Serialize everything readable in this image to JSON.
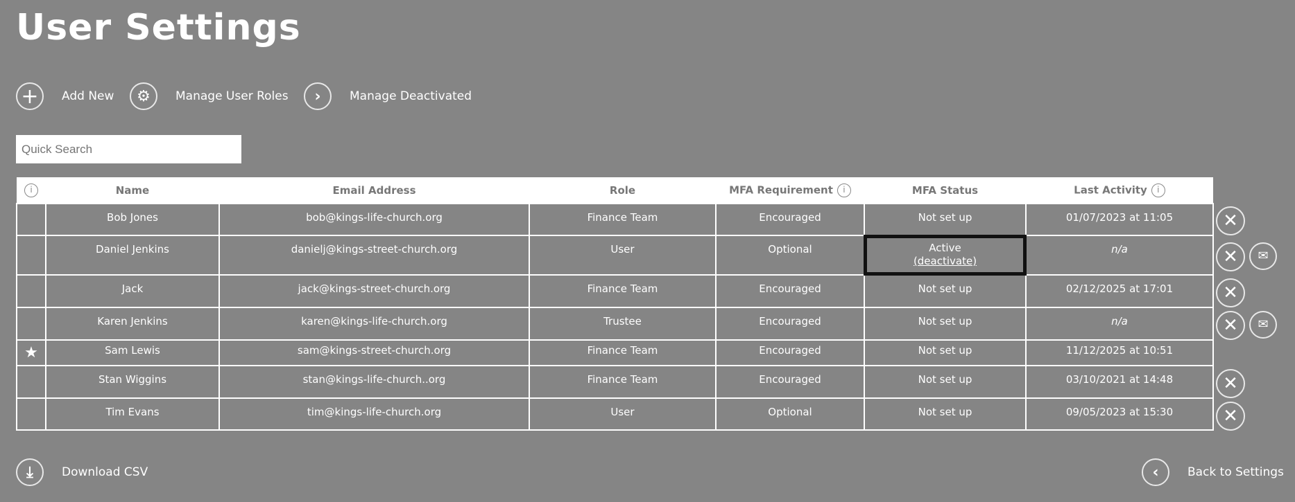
{
  "title": "User Settings",
  "toolbar": {
    "add_new": "Add New",
    "manage_roles": "Manage User Roles",
    "manage_deactivated": "Manage Deactivated"
  },
  "search": {
    "placeholder": "Quick Search"
  },
  "columns": [
    "Name",
    "Email Address",
    "Role",
    "MFA Requirement",
    "MFA Status",
    "Last Activity"
  ],
  "rows": [
    {
      "name": "Bob Jones",
      "email": "bob@kings-life-church.org",
      "role": "Finance Team",
      "mfa_req": "Encouraged",
      "mfa_status": "Not set up",
      "last": "01/07/2023 at 11:05"
    },
    {
      "name": "Daniel Jenkins",
      "email": "danielj@kings-street-church.org",
      "role": "User",
      "mfa_req": "Optional",
      "mfa_status": "Active",
      "mfa_link": "(deactivate)",
      "last": "n/a"
    },
    {
      "name": "Jack",
      "email": "jack@kings-street-church.org",
      "role": "Finance Team",
      "mfa_req": "Encouraged",
      "mfa_status": "Not set up",
      "last": "02/12/2025 at 17:01"
    },
    {
      "name": "Karen Jenkins",
      "email": "karen@kings-life-church.org",
      "role": "Trustee",
      "mfa_req": "Encouraged",
      "mfa_status": "Not set up",
      "last": "n/a"
    },
    {
      "name": "Sam Lewis",
      "email": "sam@kings-street-church.org",
      "role": "Finance Team",
      "mfa_req": "Encouraged",
      "mfa_status": "Not set up",
      "last": "11/12/2025 at 10:51"
    },
    {
      "name": "Stan Wiggins",
      "email": "stan@kings-life-church..org",
      "role": "Finance Team",
      "mfa_req": "Encouraged",
      "mfa_status": "Not set up",
      "last": "03/10/2021 at 14:48"
    },
    {
      "name": "Tim Evans",
      "email": "tim@kings-life-church.org",
      "role": "User",
      "mfa_req": "Optional",
      "mfa_status": "Not set up",
      "last": "09/05/2023 at 15:30"
    }
  ],
  "footer": {
    "download": "Download CSV",
    "back": "Back to Settings"
  }
}
